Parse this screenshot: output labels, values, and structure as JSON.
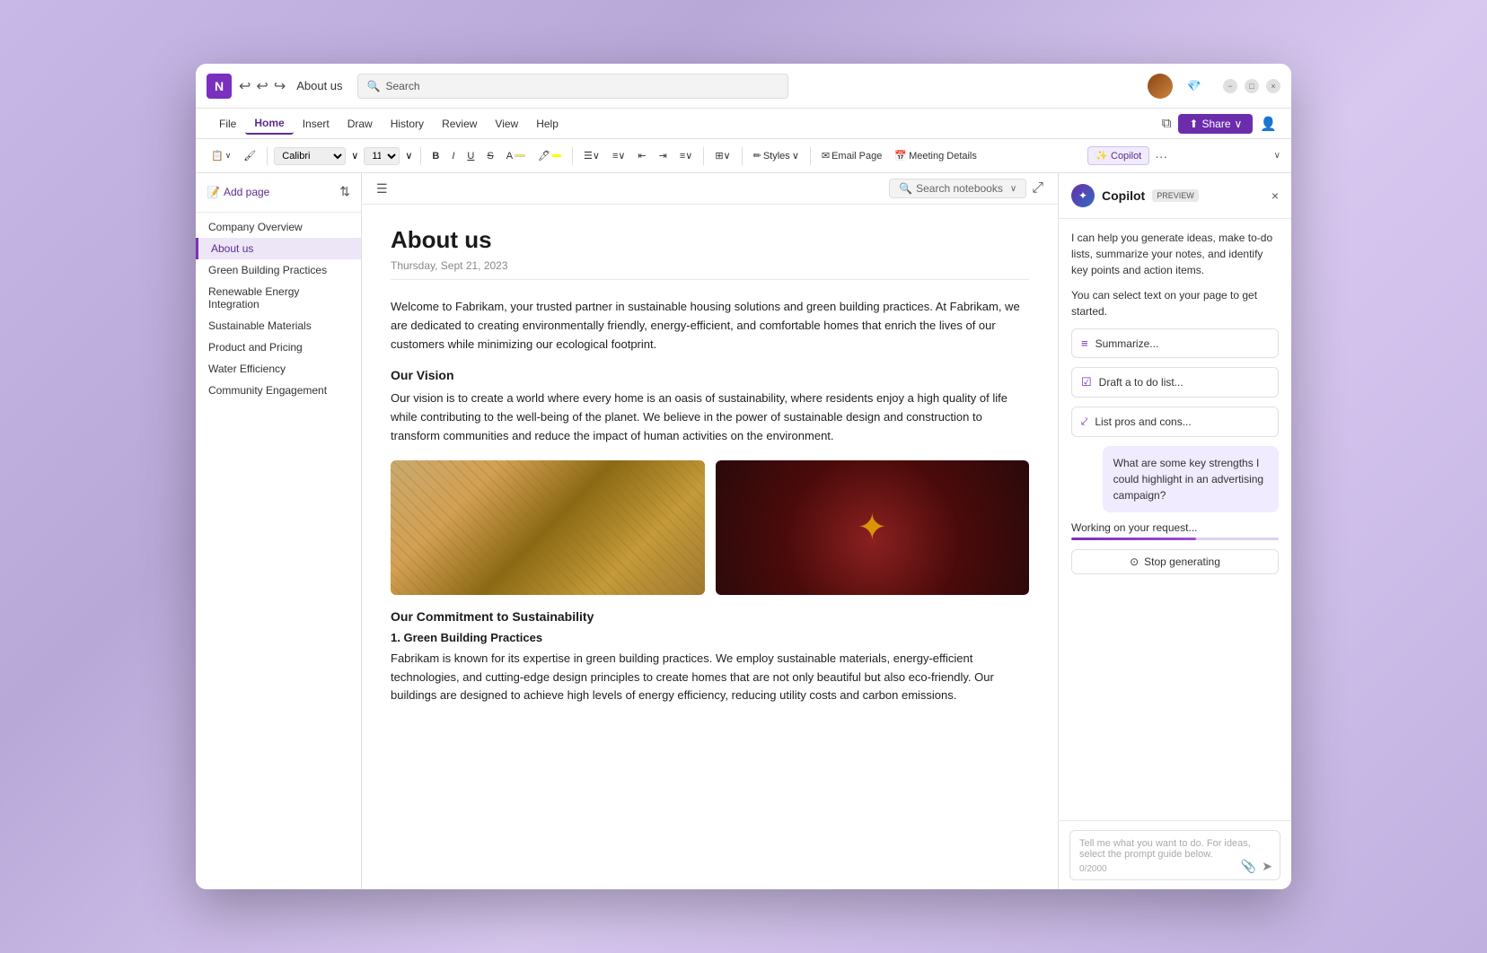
{
  "window": {
    "title": "About us"
  },
  "titlebar": {
    "onenote_label": "N",
    "search_placeholder": "Search",
    "undo_icon": "↩",
    "redo_icon": "↪",
    "minimize_icon": "−",
    "maximize_icon": "□",
    "close_icon": "×"
  },
  "menubar": {
    "items": [
      {
        "id": "file",
        "label": "File"
      },
      {
        "id": "home",
        "label": "Home",
        "active": true
      },
      {
        "id": "insert",
        "label": "Insert"
      },
      {
        "id": "draw",
        "label": "Draw"
      },
      {
        "id": "history",
        "label": "History"
      },
      {
        "id": "review",
        "label": "Review"
      },
      {
        "id": "view",
        "label": "View"
      },
      {
        "id": "help",
        "label": "Help"
      }
    ],
    "share_label": "Share"
  },
  "toolbar": {
    "font_family": "Calibri",
    "font_size": "11",
    "bold": "B",
    "italic": "I",
    "underline": "U",
    "strikethrough": "S",
    "styles_label": "Styles",
    "email_page_label": "Email Page",
    "meeting_details_label": "Meeting Details",
    "copilot_label": "Copilot",
    "more_icon": "···",
    "collapse_icon": "∨"
  },
  "sidebar": {
    "add_page_label": "Add page",
    "pages": [
      {
        "id": "company-overview",
        "label": "Company Overview"
      },
      {
        "id": "about-us",
        "label": "About us",
        "active": true
      },
      {
        "id": "green-building",
        "label": "Green Building Practices"
      },
      {
        "id": "renewable-energy",
        "label": "Renewable Energy Integration"
      },
      {
        "id": "sustainable-materials",
        "label": "Sustainable Materials"
      },
      {
        "id": "product-pricing",
        "label": "Product and Pricing"
      },
      {
        "id": "water-efficiency",
        "label": "Water Efficiency"
      },
      {
        "id": "community-engagement",
        "label": "Community Engagement"
      }
    ],
    "search_notebooks_placeholder": "Search notebooks"
  },
  "content": {
    "page_title": "About us",
    "page_date": "Thursday, Sept 21, 2023",
    "intro_text": "Welcome to Fabrikam, your trusted partner in sustainable housing solutions and green building practices. At Fabrikam, we are dedicated to creating environmentally friendly, energy-efficient, and comfortable homes that enrich the lives of our customers while minimizing our ecological footprint.",
    "vision_heading": "Our Vision",
    "vision_text": "Our vision is to create a world where every home is an oasis of sustainability, where residents enjoy a high quality of life while contributing to the well-being of the planet. We believe in the power of sustainable design and construction to transform communities and reduce the impact of human activities on the environment.",
    "commitment_heading": "Our Commitment to Sustainability",
    "commitment_sub": "1. Green Building Practices",
    "commitment_text": "Fabrikam is known for its expertise in green building practices. We employ sustainable materials, energy-efficient technologies, and cutting-edge design principles to create homes that are not only beautiful but also eco-friendly. Our buildings are designed to achieve high levels of energy efficiency, reducing utility costs and carbon emissions."
  },
  "copilot": {
    "title": "Copilot",
    "preview_badge": "PREVIEW",
    "intro_text_1": "I can help you generate ideas, make to-do lists, summarize your notes, and identify key points and action items.",
    "intro_text_2": "You can select text on your page to get started.",
    "summarize_label": "Summarize...",
    "todo_label": "Draft a to do list...",
    "pros_cons_label": "List pros and cons...",
    "user_message": "What are some key strengths I could highlight in an advertising campaign?",
    "working_text": "Working on your request...",
    "stop_generating_label": "Stop generating",
    "input_placeholder": "Tell me what you want to do. For ideas, select the prompt guide below.",
    "char_count": "0/2000",
    "summarize_icon": "≡",
    "todo_icon": "☑",
    "pros_cons_icon": "⤦"
  }
}
